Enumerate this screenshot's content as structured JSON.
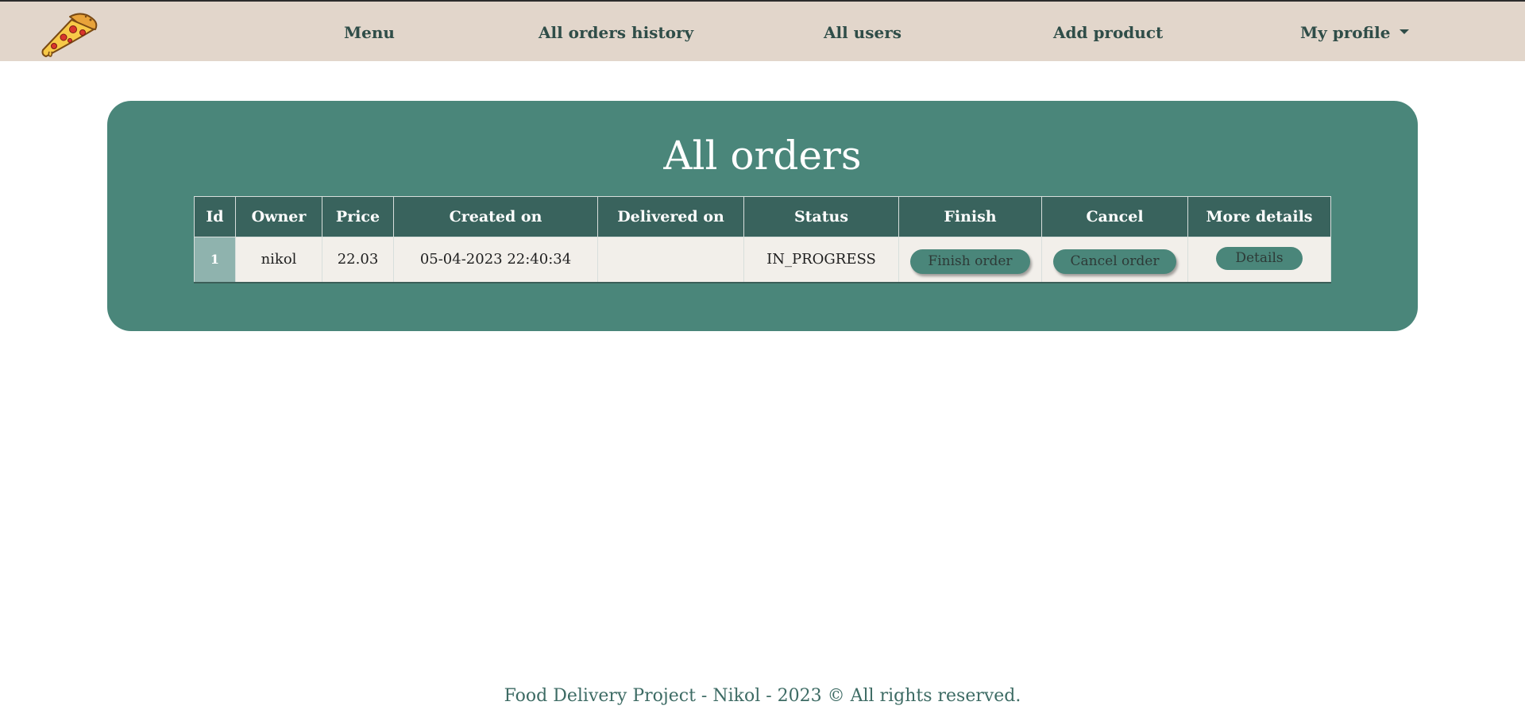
{
  "navbar": {
    "logo_icon": "pizza-slice-icon",
    "links": {
      "menu": "Menu",
      "history": "All orders history",
      "users": "All users",
      "add_product": "Add product",
      "profile": "My profile"
    }
  },
  "panel": {
    "title": "All orders"
  },
  "table": {
    "headers": {
      "id": "Id",
      "owner": "Owner",
      "price": "Price",
      "created": "Created on",
      "delivered": "Delivered on",
      "status": "Status",
      "finish": "Finish",
      "cancel": "Cancel",
      "details": "More details"
    },
    "rows": [
      {
        "id": "1",
        "owner": "nikol",
        "price": "22.03",
        "created": "05-04-2023 22:40:34",
        "delivered": "",
        "status": "IN_PROGRESS",
        "finish_label": "Finish order",
        "cancel_label": "Cancel order",
        "details_label": "Details"
      }
    ]
  },
  "footer": {
    "text": "Food Delivery Project - Nikol - 2023 © All rights reserved."
  },
  "colors": {
    "navbar_bg": "#e2d6cb",
    "panel_bg": "#4a867a",
    "table_header_bg": "#39635d",
    "row_bg": "#f2efea",
    "id_cell_bg": "#8fb3ae",
    "nav_text": "#2f4d48"
  }
}
